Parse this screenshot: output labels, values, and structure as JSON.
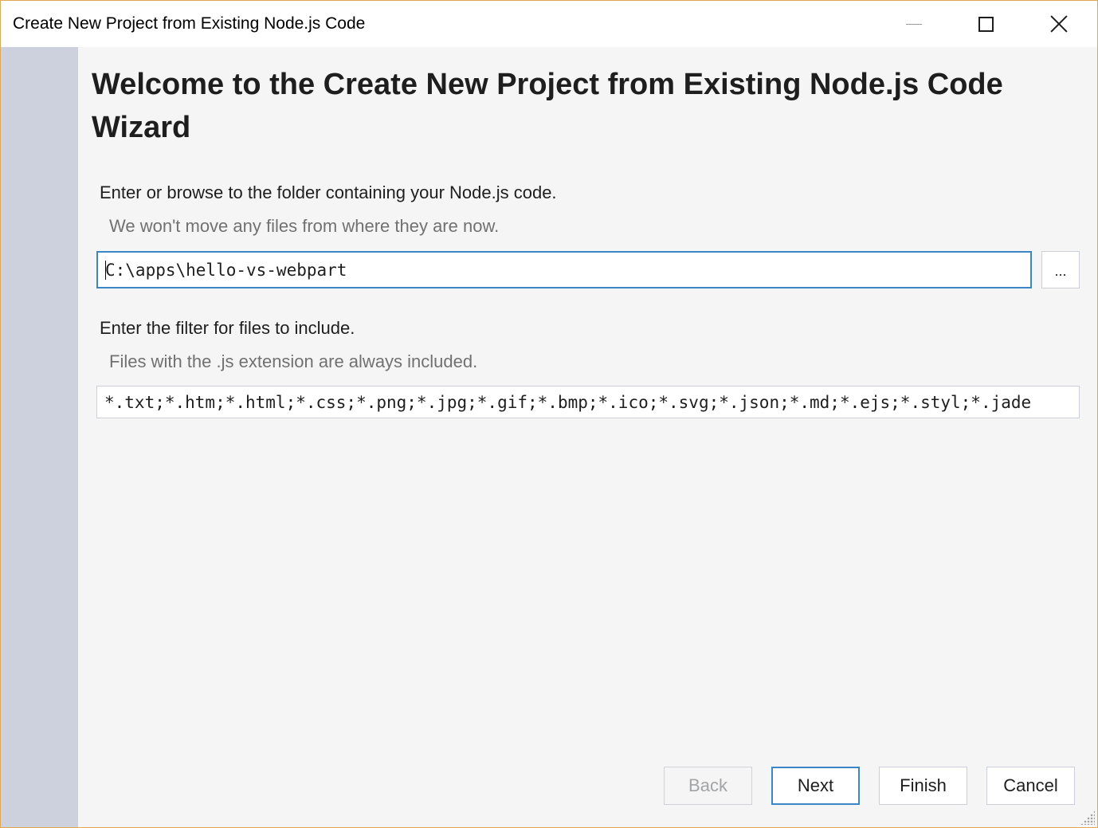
{
  "window": {
    "title": "Create New Project from Existing Node.js Code"
  },
  "wizard": {
    "heading": "Welcome to the Create New Project from Existing Node.js Code Wizard",
    "folder_label": "Enter or browse to the folder containing your Node.js code.",
    "folder_hint": "We won't move any files from where they are now.",
    "folder_value": "C:\\apps\\hello-vs-webpart",
    "browse_label": "...",
    "filter_label": "Enter the filter for files to include.",
    "filter_hint": "Files with the .js extension are always included.",
    "filter_value": "*.txt;*.htm;*.html;*.css;*.png;*.jpg;*.gif;*.bmp;*.ico;*.svg;*.json;*.md;*.ejs;*.styl;*.jade"
  },
  "buttons": {
    "back": "Back",
    "next": "Next",
    "finish": "Finish",
    "cancel": "Cancel"
  },
  "icons": {
    "minimize": "minimize-icon",
    "maximize": "maximize-icon",
    "close": "close-icon",
    "resize": "resize-grip-icon"
  },
  "colors": {
    "accent": "#3b86c7",
    "sidebar": "#cdd0dd",
    "window_border": "#e0a850"
  }
}
